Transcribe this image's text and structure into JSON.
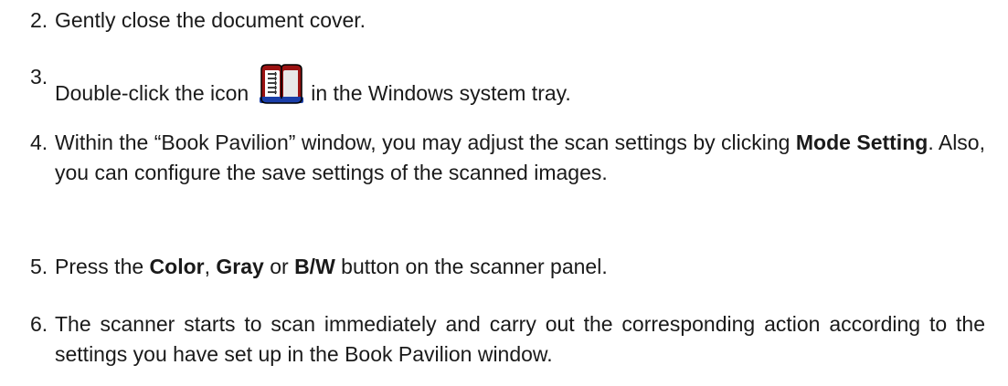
{
  "steps": [
    {
      "number": "2.",
      "text": "Gently close the document cover."
    },
    {
      "number": "3.",
      "text_before_icon": "Double-click the icon",
      "icon": "book-pavilion-tray-icon",
      "text_after_icon": "in the Windows system tray."
    },
    {
      "number": "4.",
      "text_1": "Within the “Book Pavilion” window, you may adjust the scan settings by clicking",
      "bold_1": "Mode Setting",
      "text_2": ". Also, you can configure the save settings of the scanned images."
    },
    {
      "number": "5.",
      "text_1": "Press the",
      "bold_1": "Color",
      "text_2": ",",
      "bold_2": "Gray",
      "text_3": "or",
      "bold_3": "B/W",
      "text_4": "button on the scanner panel."
    },
    {
      "number": "6.",
      "text": "The scanner starts to scan immediately and carry out the corresponding action according to the settings you have set up in the Book Pavilion window."
    }
  ]
}
